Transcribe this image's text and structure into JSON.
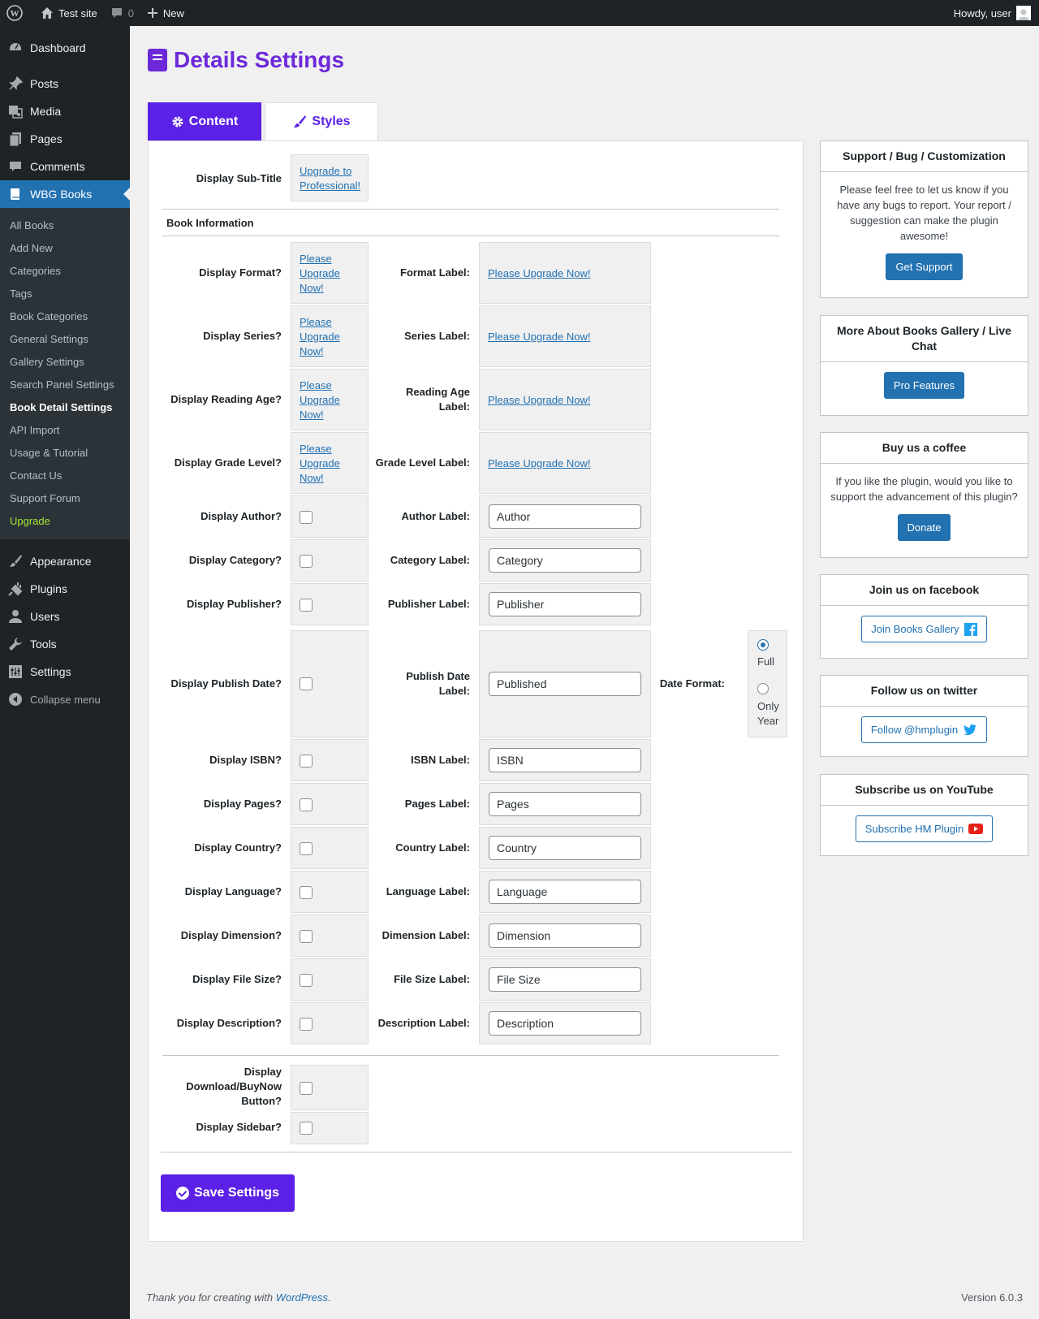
{
  "adminbar": {
    "site_name": "Test site",
    "comments_count": "0",
    "new_label": "New",
    "howdy": "Howdy, user"
  },
  "sidebar": {
    "items_top": [
      {
        "label": "Dashboard",
        "icon": "dashboard-icon"
      }
    ],
    "items_mid": [
      {
        "label": "Posts",
        "icon": "pin-icon"
      },
      {
        "label": "Media",
        "icon": "media-icon"
      },
      {
        "label": "Pages",
        "icon": "pages-icon"
      },
      {
        "label": "Comments",
        "icon": "comment-icon"
      }
    ],
    "active_item": {
      "label": "WBG Books",
      "icon": "book-icon"
    },
    "submenu": [
      "All Books",
      "Add New",
      "Categories",
      "Tags",
      "Book Categories",
      "General Settings",
      "Gallery Settings",
      "Search Panel Settings",
      "Book Detail Settings",
      "API Import",
      "Usage & Tutorial",
      "Contact Us",
      "Support Forum",
      "Upgrade"
    ],
    "items_bottom": [
      {
        "label": "Appearance",
        "icon": "brush-icon"
      },
      {
        "label": "Plugins",
        "icon": "plugin-icon"
      },
      {
        "label": "Users",
        "icon": "user-icon"
      },
      {
        "label": "Tools",
        "icon": "wrench-icon"
      },
      {
        "label": "Settings",
        "icon": "settings-icon"
      }
    ],
    "collapse_label": "Collapse menu"
  },
  "page": {
    "title": "Details Settings",
    "tabs": [
      "Content",
      "Styles"
    ],
    "sub_title_label": "Display Sub-Title",
    "sub_title_upgrade": [
      "Upgrade to",
      "Professional!"
    ],
    "section_book_info": "Book Information",
    "upgrade_short": [
      "Please",
      "Upgrade",
      "Now!"
    ],
    "upgrade_long": "Please Upgrade Now!",
    "upgrade_rows": [
      {
        "display": "Display Format?",
        "label": "Format Label:"
      },
      {
        "display": "Display Series?",
        "label": "Series Label:"
      },
      {
        "display": "Display Reading Age?",
        "label_lines": [
          "Reading Age",
          "Label:"
        ]
      },
      {
        "display": "Display Grade Level?",
        "label": "Grade Level Label:"
      }
    ],
    "field_rows_a": [
      {
        "display": "Display Author?",
        "label": "Author Label:",
        "value": "Author"
      },
      {
        "display": "Display Category?",
        "label": "Category Label:",
        "value": "Category"
      },
      {
        "display": "Display Publisher?",
        "label": "Publisher Label:",
        "value": "Publisher"
      }
    ],
    "publish_row": {
      "display": "Display Publish Date?",
      "label_lines": [
        "Publish Date",
        "Label:"
      ],
      "value": "Published",
      "date_format_label": "Date Format:",
      "option_full": "Full",
      "option_year": [
        "Only",
        "Year"
      ]
    },
    "field_rows_b": [
      {
        "display": "Display ISBN?",
        "label": "ISBN Label:",
        "value": "ISBN"
      },
      {
        "display": "Display Pages?",
        "label": "Pages Label:",
        "value": "Pages"
      },
      {
        "display": "Display Country?",
        "label": "Country Label:",
        "value": "Country"
      },
      {
        "display": "Display Language?",
        "label": "Language Label:",
        "value": "Language"
      },
      {
        "display": "Display Dimension?",
        "label": "Dimension Label:",
        "value": "Dimension"
      },
      {
        "display": "Display File Size?",
        "label": "File Size Label:",
        "value": "File Size"
      },
      {
        "display": "Display Description?",
        "label": "Description Label:",
        "value": "Description"
      }
    ],
    "download_label": [
      "Display",
      "Download/BuyNow",
      "Button?"
    ],
    "sidebar_label": "Display Sidebar?",
    "save_label": "Save Settings"
  },
  "widgets": [
    {
      "title": "Support / Bug / Customization",
      "text": "Please feel free to let us know if you have any bugs to report. Your report / suggestion can make the plugin awesome!",
      "button": "Get Support"
    },
    {
      "title": "More About Books Gallery / Live Chat",
      "button": "Pro Features"
    },
    {
      "title": "Buy us a coffee",
      "text": "If you like the plugin, would you like to support the advancement of this plugin?",
      "button": "Donate"
    },
    {
      "title": "Join us on facebook",
      "button": "Join Books Gallery",
      "icon": "facebook-icon"
    },
    {
      "title": "Follow us on twitter",
      "button": "Follow @hmplugin",
      "icon": "twitter-icon"
    },
    {
      "title": "Subscribe us on YouTube",
      "button": "Subscribe HM Plugin",
      "icon": "youtube-icon"
    }
  ],
  "footer": {
    "thanks_prefix": "Thank you for creating with ",
    "wp_link": "WordPress",
    "thanks_suffix": ".",
    "version": "Version 6.0.3"
  },
  "colors": {
    "accent": "#5b21e6",
    "wp_blue": "#2271b1",
    "admin_dark": "#1d2327"
  }
}
